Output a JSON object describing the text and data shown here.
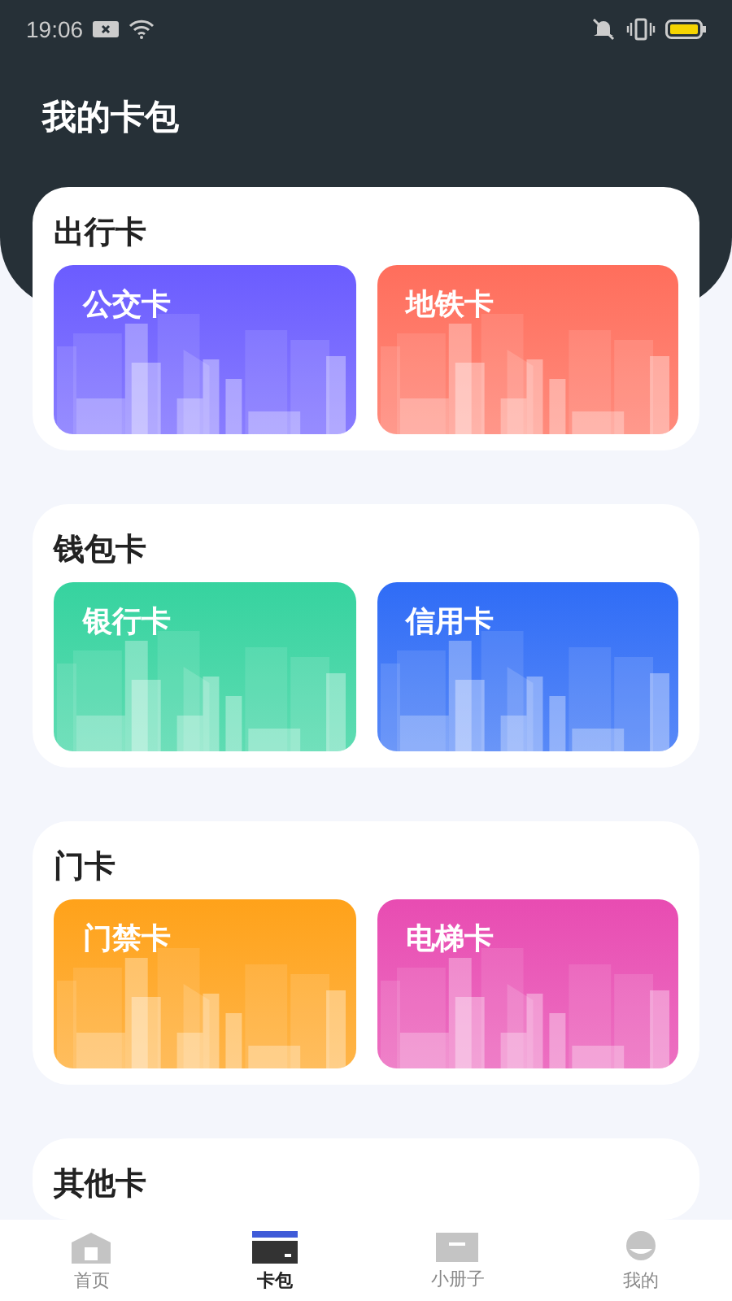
{
  "status_bar": {
    "time": "19:06"
  },
  "title": "我的卡包",
  "sections": [
    {
      "title": "出行卡",
      "cards": [
        {
          "label": "公交卡",
          "color": "#6b5cff"
        },
        {
          "label": "地铁卡",
          "color": "#ff6e5c"
        }
      ]
    },
    {
      "title": "钱包卡",
      "cards": [
        {
          "label": "银行卡",
          "color": "#36d39f"
        },
        {
          "label": "信用卡",
          "color": "#2f6cf6"
        }
      ]
    },
    {
      "title": "门卡",
      "cards": [
        {
          "label": "门禁卡",
          "color": "#ffa21a"
        },
        {
          "label": "电梯卡",
          "color": "#e84cb2"
        }
      ]
    },
    {
      "title": "其他卡"
    }
  ],
  "nav": [
    {
      "label": "首页",
      "selected": false
    },
    {
      "label": "卡包",
      "selected": true
    },
    {
      "label": "小册子",
      "selected": false
    },
    {
      "label": "我的",
      "selected": false
    }
  ]
}
